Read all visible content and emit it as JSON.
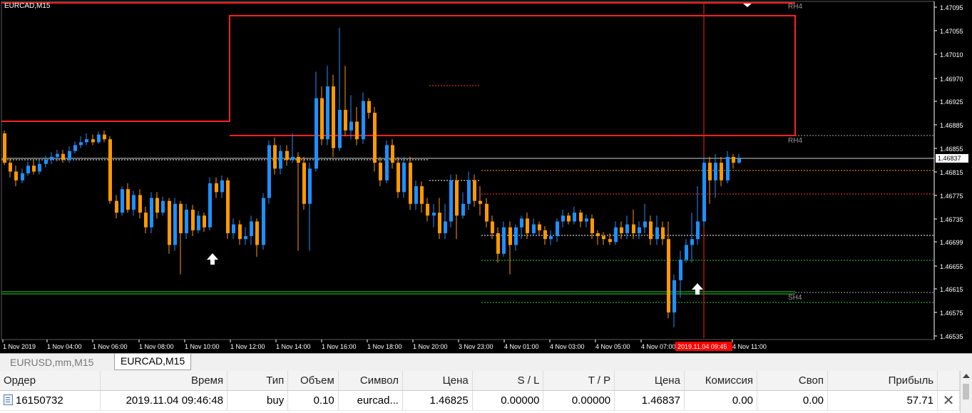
{
  "window": {
    "symbol_label": "EURCAD,M15"
  },
  "colors": {
    "bull": "#1e90ff",
    "bear": "#ff9900",
    "zone": "#ff2020",
    "support": "#33cc33",
    "price_line": "#ffffff",
    "current_bg": "#ffffff",
    "time_marker_bg": "#ff0000"
  },
  "chart": {
    "price_axis": [
      "1.47095",
      "1.47055",
      "1.47010",
      "1.46970",
      "1.46925",
      "1.46885",
      "1.46855",
      "1.46815",
      "1.46775",
      "1.46735",
      "1.46699",
      "1.46655",
      "1.46615",
      "1.46575",
      "1.46535"
    ],
    "current_price": "1.46837",
    "time_axis": [
      "1 Nov 2019",
      "1 Nov 04:00",
      "1 Nov 06:00",
      "1 Nov 08:00",
      "1 Nov 10:00",
      "1 Nov 12:00",
      "1 Nov 14:00",
      "1 Nov 16:00",
      "1 Nov 18:00",
      "1 Nov 20:00",
      "3 Nov 23:00",
      "4 Nov 01:00",
      "4 Nov 03:00",
      "4 Nov 05:00",
      "4 Nov 07:00",
      "4 Nov 11:00"
    ],
    "time_marker": "2019.11.04 09:45",
    "labels": {
      "rh4_top": "RH4",
      "rh4_mid": "RH4",
      "sh4": "SH4"
    },
    "candles": [
      [
        1.4688,
        1.4683,
        1.46885,
        1.46826
      ],
      [
        1.4683,
        1.46815,
        1.46838,
        1.46805
      ],
      [
        1.46815,
        1.468,
        1.46825,
        1.4679
      ],
      [
        1.468,
        1.46812,
        1.4682,
        1.46795
      ],
      [
        1.46812,
        1.46825,
        1.46832,
        1.46808
      ],
      [
        1.46825,
        1.46815,
        1.46835,
        1.4681
      ],
      [
        1.46815,
        1.46828,
        1.46836,
        1.4681
      ],
      [
        1.46828,
        1.46835,
        1.46842,
        1.46822
      ],
      [
        1.46835,
        1.4684,
        1.46848,
        1.46828
      ],
      [
        1.4684,
        1.46845,
        1.46852,
        1.46832
      ],
      [
        1.46845,
        1.46835,
        1.46852,
        1.4683
      ],
      [
        1.46835,
        1.4685,
        1.46858,
        1.4683
      ],
      [
        1.4685,
        1.4686,
        1.46866,
        1.46846
      ],
      [
        1.4686,
        1.46865,
        1.46875,
        1.46855
      ],
      [
        1.46865,
        1.4687,
        1.4688,
        1.4686
      ],
      [
        1.4687,
        1.46865,
        1.46878,
        1.4686
      ],
      [
        1.46865,
        1.46878,
        1.46883,
        1.46862
      ],
      [
        1.46878,
        1.4687,
        1.46885,
        1.46865
      ],
      [
        1.4687,
        1.46765,
        1.46875,
        1.4676
      ],
      [
        1.46765,
        1.46745,
        1.46775,
        1.46735
      ],
      [
        1.46745,
        1.46785,
        1.4679,
        1.4674
      ],
      [
        1.46785,
        1.4675,
        1.46795,
        1.46745
      ],
      [
        1.4675,
        1.46775,
        1.46782,
        1.4674
      ],
      [
        1.46775,
        1.46745,
        1.46785,
        1.46735
      ],
      [
        1.46745,
        1.4672,
        1.46755,
        1.4671
      ],
      [
        1.4672,
        1.4677,
        1.4678,
        1.4671
      ],
      [
        1.4677,
        1.46745,
        1.4678,
        1.46735
      ],
      [
        1.46745,
        1.46765,
        1.46772,
        1.4674
      ],
      [
        1.46765,
        1.4669,
        1.4677,
        1.46675
      ],
      [
        1.4669,
        1.4676,
        1.4677,
        1.4668
      ],
      [
        1.4676,
        1.4671,
        1.46765,
        1.4664
      ],
      [
        1.4671,
        1.4675,
        1.4676,
        1.467
      ],
      [
        1.4675,
        1.46715,
        1.46758,
        1.46705
      ],
      [
        1.46715,
        1.4674,
        1.46748,
        1.4671
      ],
      [
        1.4674,
        1.4672,
        1.46745,
        1.46712
      ],
      [
        1.4672,
        1.46795,
        1.46805,
        1.46715
      ],
      [
        1.46795,
        1.4678,
        1.46805,
        1.4677
      ],
      [
        1.4678,
        1.468,
        1.46808,
        1.4677
      ],
      [
        1.468,
        1.4671,
        1.46805,
        1.467
      ],
      [
        1.4671,
        1.46725,
        1.46735,
        1.467
      ],
      [
        1.46725,
        1.467,
        1.46732,
        1.4669
      ],
      [
        1.467,
        1.46705,
        1.4672,
        1.4669
      ],
      [
        1.46705,
        1.4673,
        1.4674,
        1.4669
      ],
      [
        1.4673,
        1.4669,
        1.46735,
        1.4667
      ],
      [
        1.4669,
        1.4677,
        1.46778,
        1.46682
      ],
      [
        1.4677,
        1.4686,
        1.46868,
        1.4676
      ],
      [
        1.4686,
        1.4682,
        1.46873,
        1.4681
      ],
      [
        1.4682,
        1.4685,
        1.4686,
        1.4681
      ],
      [
        1.4685,
        1.46835,
        1.4686,
        1.46825
      ],
      [
        1.46835,
        1.4684,
        1.4688,
        1.4683
      ],
      [
        1.4684,
        1.4683,
        1.46848,
        1.4668
      ],
      [
        1.4683,
        1.4676,
        1.4684,
        1.4675
      ],
      [
        1.4676,
        1.4682,
        1.4683,
        1.4668
      ],
      [
        1.4682,
        1.4694,
        1.46985,
        1.46815
      ],
      [
        1.4694,
        1.4687,
        1.4696,
        1.4686
      ],
      [
        1.4687,
        1.4696,
        1.46995,
        1.4686
      ],
      [
        1.4696,
        1.46855,
        1.4698,
        1.4684
      ],
      [
        1.46855,
        1.4692,
        1.4706,
        1.4685
      ],
      [
        1.4692,
        1.46885,
        1.46995,
        1.46875
      ],
      [
        1.46885,
        1.469,
        1.46945,
        1.4687
      ],
      [
        1.469,
        1.4687,
        1.46925,
        1.4686
      ],
      [
        1.4687,
        1.46935,
        1.4695,
        1.46862
      ],
      [
        1.46935,
        1.46915,
        1.4694,
        1.46905
      ],
      [
        1.46915,
        1.4683,
        1.46925,
        1.46815
      ],
      [
        1.4683,
        1.468,
        1.4684,
        1.4679
      ],
      [
        1.468,
        1.4686,
        1.46868,
        1.46795
      ],
      [
        1.4686,
        1.4683,
        1.4687,
        1.4682
      ],
      [
        1.4683,
        1.4678,
        1.4684,
        1.4677
      ],
      [
        1.4678,
        1.4683,
        1.4684,
        1.4677
      ],
      [
        1.4683,
        1.4676,
        1.4684,
        1.4675
      ],
      [
        1.4676,
        1.4679,
        1.468,
        1.4675
      ],
      [
        1.4679,
        1.4676,
        1.46798,
        1.46745
      ],
      [
        1.4676,
        1.4674,
        1.4677,
        1.4673
      ],
      [
        1.4674,
        1.46745,
        1.4676,
        1.4672
      ],
      [
        1.46745,
        1.4671,
        1.4677,
        1.467
      ],
      [
        1.4671,
        1.4673,
        1.4676,
        1.467
      ],
      [
        1.4673,
        1.468,
        1.4681,
        1.4672
      ],
      [
        1.468,
        1.4674,
        1.4681,
        1.467
      ],
      [
        1.4674,
        1.4676,
        1.4678,
        1.46735
      ],
      [
        1.4676,
        1.468,
        1.46815,
        1.4675
      ],
      [
        1.468,
        1.46765,
        1.4681,
        1.46755
      ],
      [
        1.46765,
        1.4676,
        1.4679,
        1.4674
      ],
      [
        1.4676,
        1.4673,
        1.4677,
        1.4672
      ],
      [
        1.4673,
        1.4671,
        1.4674,
        1.467
      ],
      [
        1.4671,
        1.46675,
        1.4672,
        1.4666
      ],
      [
        1.46675,
        1.4672,
        1.4673,
        1.4667
      ],
      [
        1.4672,
        1.4669,
        1.4673,
        1.4664
      ],
      [
        1.4669,
        1.4672,
        1.46725,
        1.4668
      ],
      [
        1.4672,
        1.46735,
        1.4674,
        1.467
      ],
      [
        1.46735,
        1.4671,
        1.46745,
        1.467
      ],
      [
        1.4671,
        1.46725,
        1.46735,
        1.46705
      ],
      [
        1.46725,
        1.46715,
        1.4673,
        1.46705
      ],
      [
        1.46715,
        1.467,
        1.46722,
        1.4669
      ],
      [
        1.467,
        1.46705,
        1.46715,
        1.4669
      ],
      [
        1.46705,
        1.4673,
        1.46735,
        1.46695
      ],
      [
        1.4673,
        1.4674,
        1.4675,
        1.4672
      ],
      [
        1.4674,
        1.4673,
        1.46745,
        1.46725
      ],
      [
        1.4673,
        1.46745,
        1.46755,
        1.46725
      ],
      [
        1.46745,
        1.4673,
        1.4675,
        1.4672
      ],
      [
        1.4673,
        1.46735,
        1.46742,
        1.4672
      ],
      [
        1.46735,
        1.4671,
        1.46742,
        1.467
      ],
      [
        1.4671,
        1.46705,
        1.46715,
        1.4669
      ],
      [
        1.46705,
        1.467,
        1.46712,
        1.4669
      ],
      [
        1.467,
        1.46695,
        1.4671,
        1.4669
      ],
      [
        1.46695,
        1.4672,
        1.4673,
        1.4669
      ],
      [
        1.4672,
        1.4671,
        1.4673,
        1.467
      ],
      [
        1.4671,
        1.46725,
        1.4674,
        1.467
      ],
      [
        1.46725,
        1.4671,
        1.4675,
        1.467
      ],
      [
        1.4671,
        1.4672,
        1.4673,
        1.467
      ],
      [
        1.4672,
        1.4673,
        1.4676,
        1.4671
      ],
      [
        1.4673,
        1.467,
        1.4674,
        1.4669
      ],
      [
        1.467,
        1.4672,
        1.4674,
        1.4669
      ],
      [
        1.4672,
        1.467,
        1.4673,
        1.4669
      ],
      [
        1.467,
        1.46575,
        1.4673,
        1.46565
      ],
      [
        1.46575,
        1.4663,
        1.4664,
        1.4655
      ],
      [
        1.4663,
        1.46665,
        1.4668,
        1.466
      ],
      [
        1.46665,
        1.4669,
        1.467,
        1.4666
      ],
      [
        1.4669,
        1.467,
        1.46745,
        1.4666
      ],
      [
        1.467,
        1.4673,
        1.4679,
        1.4669
      ],
      [
        1.4673,
        1.4683,
        1.4684,
        1.4672
      ],
      [
        1.4683,
        1.468,
        1.4684,
        1.4676
      ],
      [
        1.468,
        1.4683,
        1.46845,
        1.4677
      ],
      [
        1.4683,
        1.468,
        1.4684,
        1.4679
      ],
      [
        1.468,
        1.4684,
        1.4685,
        1.46795
      ],
      [
        1.4684,
        1.4683,
        1.46845,
        1.4682
      ],
      [
        1.4683,
        1.46837,
        1.46845,
        1.46828
      ]
    ]
  },
  "tabs": [
    {
      "label": "EURUSD,mm,M15",
      "active": false
    },
    {
      "label": "EURCAD,M15",
      "active": true
    }
  ],
  "orders": {
    "headers": {
      "order": "Ордер",
      "time": "Время",
      "type": "Тип",
      "volume": "Объем",
      "symbol": "Символ",
      "price": "Цена",
      "sl": "S / L",
      "tp": "T / P",
      "current_price": "Цена",
      "commission": "Комиссия",
      "swap": "Своп",
      "profit": "Прибыль"
    },
    "rows": [
      {
        "order": "16150732",
        "time": "2019.11.04 09:46:48",
        "type": "buy",
        "volume": "0.10",
        "symbol": "eurcad...",
        "price": "1.46825",
        "sl": "0.00000",
        "tp": "0.00000",
        "current_price": "1.46837",
        "commission": "0.00",
        "swap": "0.00",
        "profit": "57.71"
      }
    ]
  }
}
